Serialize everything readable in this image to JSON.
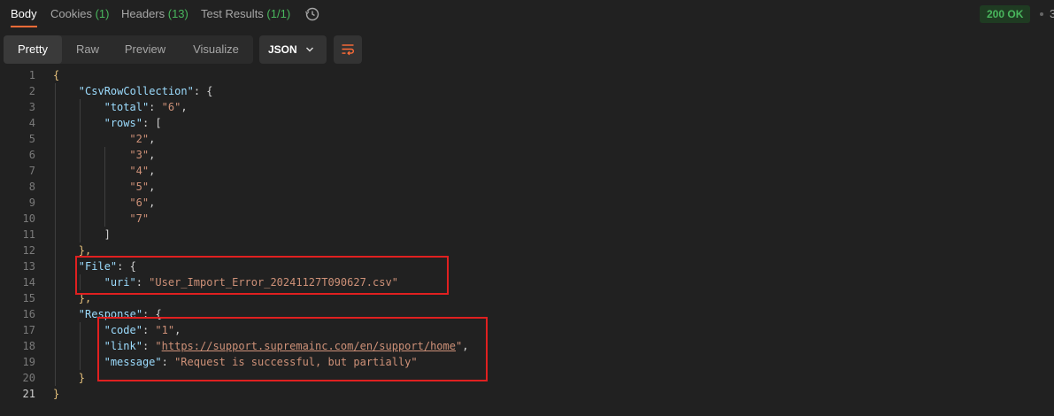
{
  "tabs": [
    {
      "label": "Body",
      "count": ""
    },
    {
      "label": "Cookies ",
      "count": "(1)"
    },
    {
      "label": "Headers ",
      "count": "(13)"
    },
    {
      "label": "Test Results ",
      "count": "(1/1)"
    }
  ],
  "status": {
    "text": "200 OK",
    "more": "3"
  },
  "view_modes": [
    "Pretty",
    "Raw",
    "Preview",
    "Visualize"
  ],
  "format": "JSON",
  "code_lines": [
    {
      "n": "1",
      "text": "{"
    },
    {
      "n": "2",
      "key": "\"CsvRowCollection\"",
      "after": ": {"
    },
    {
      "n": "3",
      "key": "\"total\"",
      "after": ": ",
      "str": "\"6\"",
      "tail": ","
    },
    {
      "n": "4",
      "key": "\"rows\"",
      "after": ": ["
    },
    {
      "n": "5",
      "str": "\"2\"",
      "tail": ","
    },
    {
      "n": "6",
      "str": "\"3\"",
      "tail": ","
    },
    {
      "n": "7",
      "str": "\"4\"",
      "tail": ","
    },
    {
      "n": "8",
      "str": "\"5\"",
      "tail": ","
    },
    {
      "n": "9",
      "str": "\"6\"",
      "tail": ","
    },
    {
      "n": "10",
      "str": "\"7\""
    },
    {
      "n": "11",
      "text": "]"
    },
    {
      "n": "12",
      "text": "},"
    },
    {
      "n": "13",
      "key": "\"File\"",
      "after": ": {"
    },
    {
      "n": "14",
      "key": "\"uri\"",
      "after": ": ",
      "str": "\"User_Import_Error_20241127T090627.csv\""
    },
    {
      "n": "15",
      "text": "},"
    },
    {
      "n": "16",
      "key": "\"Response\"",
      "after": ": {"
    },
    {
      "n": "17",
      "key": "\"code\"",
      "after": ": ",
      "str": "\"1\"",
      "tail": ","
    },
    {
      "n": "18",
      "key": "\"link\"",
      "after": ": ",
      "str_pre": "\"",
      "link": "https://support.supremainc.com/en/support/home",
      "str_post": "\"",
      "tail": ","
    },
    {
      "n": "19",
      "key": "\"message\"",
      "after": ": ",
      "str": "\"Request is successful, but partially\""
    },
    {
      "n": "20",
      "text": "}"
    },
    {
      "n": "21",
      "text": "}"
    }
  ]
}
